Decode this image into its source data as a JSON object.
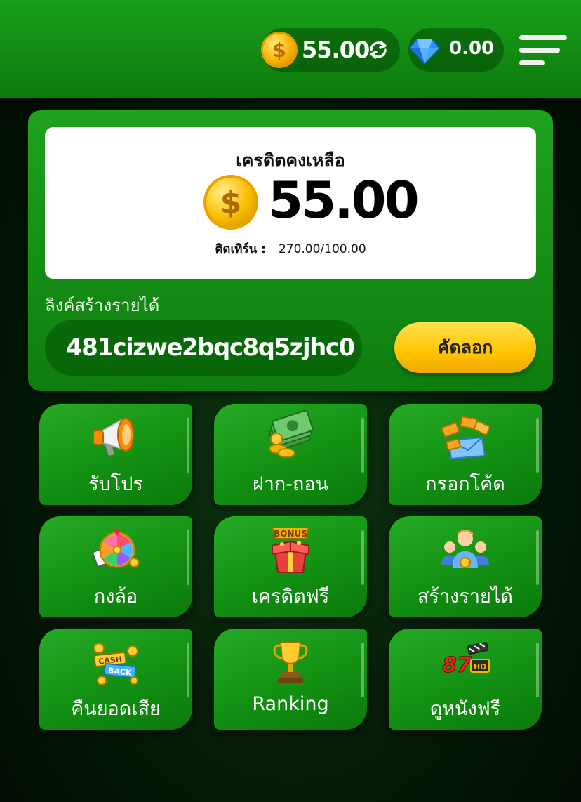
{
  "header": {
    "coin_balance": "55.00",
    "gem_balance": "0.00"
  },
  "credit_card": {
    "title": "เครดิตคงเหลือ",
    "balance": "55.00",
    "turnover_label": "ติดเทิร์น :",
    "turnover_value": "270.00/100.00",
    "link_label": "ลิงค์สร้างรายได้",
    "link_value": "481cizwe2bqc8q5zjhc0",
    "copy_label": "คัดลอก"
  },
  "menu_tiles": [
    {
      "label": "รับโปร",
      "icon": "megaphone-icon"
    },
    {
      "label": "ฝาก-ถอน",
      "icon": "money-stack-icon"
    },
    {
      "label": "กรอกโค้ด",
      "icon": "coupon-envelope-icon"
    },
    {
      "label": "กงล้อ",
      "icon": "prize-wheel-icon"
    },
    {
      "label": "เครดิตฟรี",
      "icon": "bonus-gift-icon"
    },
    {
      "label": "สร้างรายได้",
      "icon": "team-people-icon"
    },
    {
      "label": "คืนยอดเสีย",
      "icon": "cashback-icon"
    },
    {
      "label": "Ranking",
      "icon": "trophy-icon"
    },
    {
      "label": "ดูหนังฟรี",
      "icon": "movie-87hd-icon"
    }
  ],
  "colors": {
    "primary_green": "#129012",
    "accent_yellow": "#ffc400",
    "coin_gold": "#f7b500"
  }
}
